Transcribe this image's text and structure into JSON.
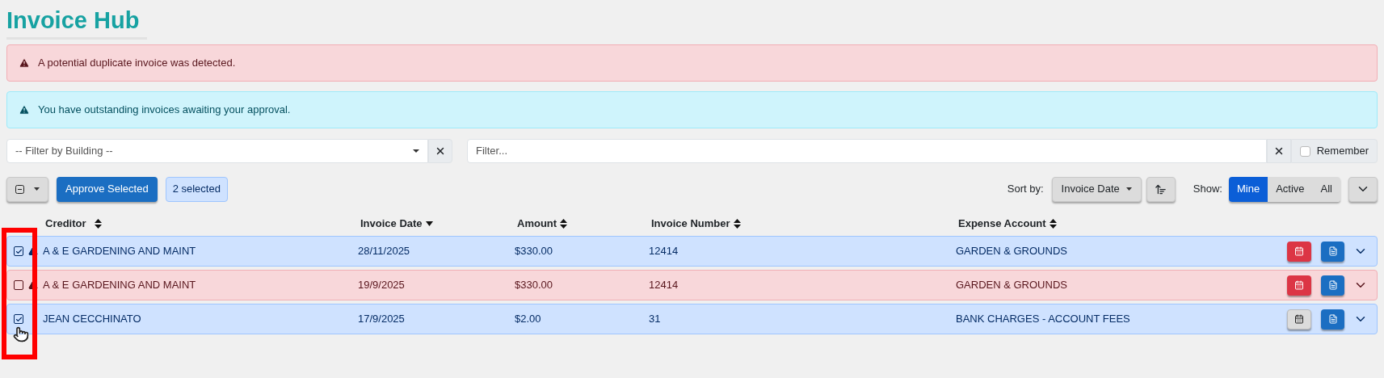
{
  "title": "Invoice Hub",
  "alerts": [
    {
      "kind": "danger",
      "text": "A potential duplicate invoice was detected."
    },
    {
      "kind": "info",
      "text": "You have outstanding invoices awaiting your approval."
    }
  ],
  "building_filter": {
    "placeholder": "-- Filter by Building --"
  },
  "text_filter": {
    "placeholder": "Filter...",
    "remember": {
      "label": "Remember",
      "checked": false
    }
  },
  "toolbar": {
    "approve_label": "Approve Selected",
    "selected_count": "2 selected",
    "sort_label": "Sort by:",
    "sort_value": "Invoice Date",
    "show_label": "Show:",
    "show_options": [
      {
        "label": "Mine",
        "selected": true
      },
      {
        "label": "Active",
        "selected": false
      },
      {
        "label": "All",
        "selected": false
      }
    ]
  },
  "table": {
    "columns": [
      {
        "label": "Creditor",
        "sorted": false
      },
      {
        "label": "Invoice Date",
        "sorted": true
      },
      {
        "label": "Amount",
        "sorted": false
      },
      {
        "label": "Invoice Number",
        "sorted": false
      },
      {
        "label": "Expense Account",
        "sorted": false
      }
    ],
    "rows": [
      {
        "checked": true,
        "duplicate": false,
        "warning": true,
        "overdue": true,
        "cells": [
          "A & E GARDENING AND MAINT",
          "28/11/2025",
          "$330.00",
          "12414",
          "GARDEN & GROUNDS"
        ]
      },
      {
        "checked": false,
        "duplicate": true,
        "warning": true,
        "overdue": true,
        "cells": [
          "A & E GARDENING AND MAINT",
          "19/9/2025",
          "$330.00",
          "12414",
          "GARDEN & GROUNDS"
        ]
      },
      {
        "checked": true,
        "duplicate": false,
        "warning": false,
        "overdue": false,
        "cells": [
          "JEAN CECCHINATO",
          "17/9/2025",
          "$2.00",
          "31",
          "BANK CHARGES - ACCOUNT FEES"
        ]
      }
    ]
  }
}
